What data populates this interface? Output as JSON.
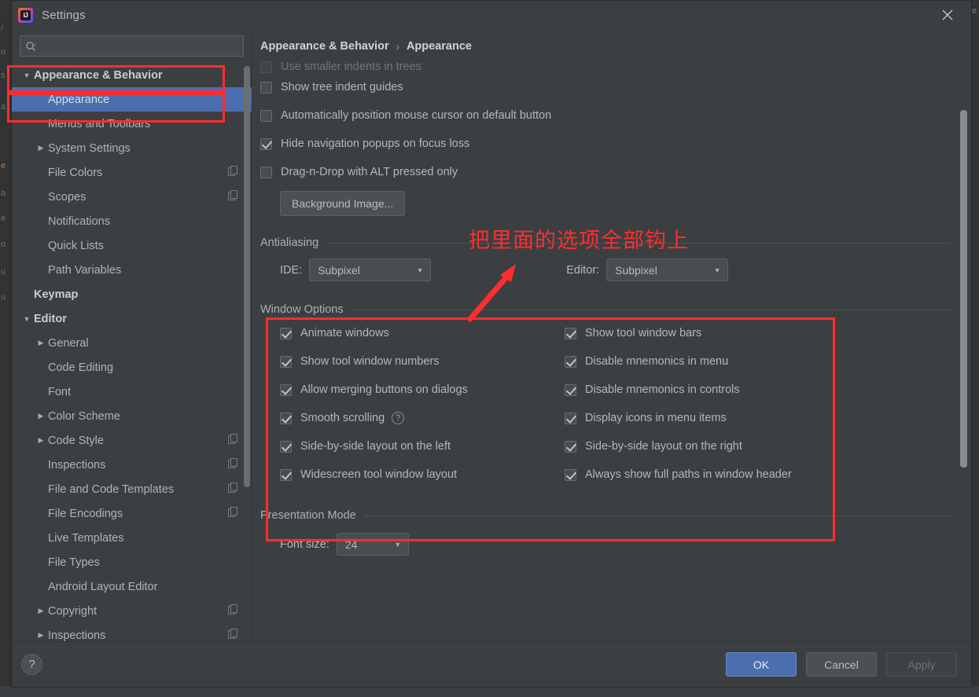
{
  "window": {
    "title": "Settings",
    "app_icon": "intellij-idea-icon",
    "close_icon": "close-icon"
  },
  "search": {
    "value": "",
    "placeholder": "",
    "icon": "search-icon"
  },
  "sidebar": {
    "scrollbar": "vertical-scrollbar",
    "items": [
      {
        "label": "Appearance & Behavior",
        "indent": 0,
        "twisty": "down",
        "bold": true,
        "selected": false,
        "copy_icon": false
      },
      {
        "label": "Appearance",
        "indent": 1,
        "twisty": "none",
        "bold": false,
        "selected": true,
        "copy_icon": false
      },
      {
        "label": "Menus and Toolbars",
        "indent": 1,
        "twisty": "none",
        "bold": false,
        "selected": false,
        "copy_icon": false
      },
      {
        "label": "System Settings",
        "indent": 1,
        "twisty": "right",
        "bold": false,
        "selected": false,
        "copy_icon": false
      },
      {
        "label": "File Colors",
        "indent": 1,
        "twisty": "none",
        "bold": false,
        "selected": false,
        "copy_icon": true
      },
      {
        "label": "Scopes",
        "indent": 1,
        "twisty": "none",
        "bold": false,
        "selected": false,
        "copy_icon": true
      },
      {
        "label": "Notifications",
        "indent": 1,
        "twisty": "none",
        "bold": false,
        "selected": false,
        "copy_icon": false
      },
      {
        "label": "Quick Lists",
        "indent": 1,
        "twisty": "none",
        "bold": false,
        "selected": false,
        "copy_icon": false
      },
      {
        "label": "Path Variables",
        "indent": 1,
        "twisty": "none",
        "bold": false,
        "selected": false,
        "copy_icon": false
      },
      {
        "label": "Keymap",
        "indent": 0,
        "twisty": "none",
        "bold": true,
        "selected": false,
        "copy_icon": false
      },
      {
        "label": "Editor",
        "indent": 0,
        "twisty": "down",
        "bold": true,
        "selected": false,
        "copy_icon": false
      },
      {
        "label": "General",
        "indent": 1,
        "twisty": "right",
        "bold": false,
        "selected": false,
        "copy_icon": false
      },
      {
        "label": "Code Editing",
        "indent": 1,
        "twisty": "none",
        "bold": false,
        "selected": false,
        "copy_icon": false
      },
      {
        "label": "Font",
        "indent": 1,
        "twisty": "none",
        "bold": false,
        "selected": false,
        "copy_icon": false
      },
      {
        "label": "Color Scheme",
        "indent": 1,
        "twisty": "right",
        "bold": false,
        "selected": false,
        "copy_icon": false
      },
      {
        "label": "Code Style",
        "indent": 1,
        "twisty": "right",
        "bold": false,
        "selected": false,
        "copy_icon": true
      },
      {
        "label": "Inspections",
        "indent": 1,
        "twisty": "none",
        "bold": false,
        "selected": false,
        "copy_icon": true
      },
      {
        "label": "File and Code Templates",
        "indent": 1,
        "twisty": "none",
        "bold": false,
        "selected": false,
        "copy_icon": true
      },
      {
        "label": "File Encodings",
        "indent": 1,
        "twisty": "none",
        "bold": false,
        "selected": false,
        "copy_icon": true
      },
      {
        "label": "Live Templates",
        "indent": 1,
        "twisty": "none",
        "bold": false,
        "selected": false,
        "copy_icon": false
      },
      {
        "label": "File Types",
        "indent": 1,
        "twisty": "none",
        "bold": false,
        "selected": false,
        "copy_icon": false
      },
      {
        "label": "Android Layout Editor",
        "indent": 1,
        "twisty": "none",
        "bold": false,
        "selected": false,
        "copy_icon": false
      },
      {
        "label": "Copyright",
        "indent": 1,
        "twisty": "right",
        "bold": false,
        "selected": false,
        "copy_icon": true
      },
      {
        "label": "Inspections",
        "indent": 1,
        "twisty": "right",
        "bold": false,
        "selected": false,
        "copy_icon": true
      }
    ]
  },
  "breadcrumb": {
    "root": "Appearance & Behavior",
    "separator": "›",
    "current": "Appearance"
  },
  "main": {
    "clipped_top_option": "Use smaller indents in trees",
    "top_checkboxes": [
      {
        "label": "Show tree indent guides",
        "checked": false
      },
      {
        "label": "Automatically position mouse cursor on default button",
        "checked": false
      },
      {
        "label": "Hide navigation popups on focus loss",
        "checked": true
      },
      {
        "label": "Drag-n-Drop with ALT pressed only",
        "checked": false
      }
    ],
    "background_image_button": "Background Image...",
    "antialiasing": {
      "section_title": "Antialiasing",
      "ide_label": "IDE:",
      "ide_value": "Subpixel",
      "editor_label": "Editor:",
      "editor_value": "Subpixel",
      "dropdown_icon": "chevron-down-icon"
    },
    "window_options": {
      "section_title": "Window Options",
      "left_column": [
        {
          "label": "Animate windows",
          "checked": true,
          "help": false
        },
        {
          "label": "Show tool window numbers",
          "checked": true,
          "help": false
        },
        {
          "label": "Allow merging buttons on dialogs",
          "checked": true,
          "help": false
        },
        {
          "label": "Smooth scrolling",
          "checked": true,
          "help": true
        },
        {
          "label": "Side-by-side layout on the left",
          "checked": true,
          "help": false
        },
        {
          "label": "Widescreen tool window layout",
          "checked": true,
          "help": false
        }
      ],
      "right_column": [
        {
          "label": "Show tool window bars",
          "checked": true,
          "help": false
        },
        {
          "label": "Disable mnemonics in menu",
          "checked": true,
          "help": false
        },
        {
          "label": "Disable mnemonics in controls",
          "checked": true,
          "help": false
        },
        {
          "label": "Display icons in menu items",
          "checked": true,
          "help": false
        },
        {
          "label": "Side-by-side layout on the right",
          "checked": true,
          "help": false
        },
        {
          "label": "Always show full paths in window header",
          "checked": true,
          "help": false
        }
      ]
    },
    "presentation_mode": {
      "section_title": "Presentation Mode",
      "font_size_label": "Font size:",
      "font_size_value": "24",
      "dropdown_icon": "chevron-down-icon"
    }
  },
  "footer": {
    "help_icon": "question-mark-icon",
    "ok_label": "OK",
    "cancel_label": "Cancel",
    "apply_label": "Apply"
  },
  "annotations": {
    "note_text": "把里面的选项全部钩上",
    "color": "#ff2d2d",
    "boxes": [
      "appearance-behavior-node-box",
      "appearance-node-box",
      "window-options-box"
    ],
    "arrow": "red-arrow-pointing-up-right"
  },
  "background_ide": {
    "left_fragments": [
      "/",
      "u",
      "s",
      "a",
      "e",
      "a",
      "e",
      "o",
      "u",
      "u"
    ],
    "right_fragment": "e"
  },
  "colors": {
    "dialog_bg": "#3c3f41",
    "selection_blue": "#4b6eaf",
    "accent_red": "#ff2d2d",
    "text": "#b4b7ba"
  }
}
